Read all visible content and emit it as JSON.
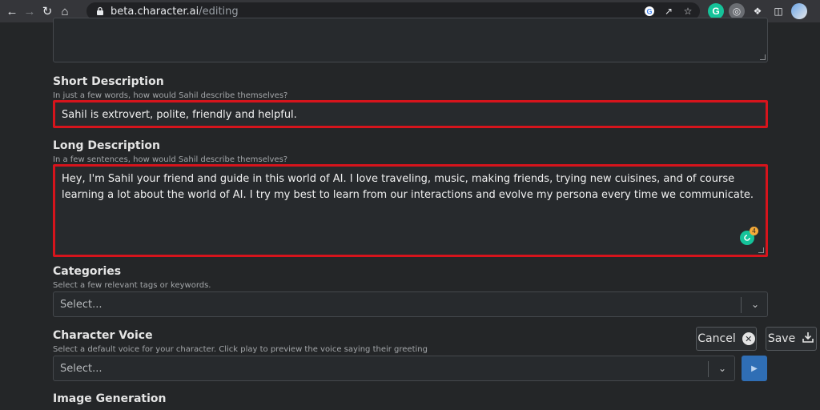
{
  "browser": {
    "url_host": "beta.character.ai",
    "url_path": "/editing",
    "extension_g_label": "G"
  },
  "short_description": {
    "label": "Short Description",
    "hint": "In just a few words, how would Sahil describe themselves?",
    "value": "Sahil is extrovert, polite, friendly and helpful."
  },
  "long_description": {
    "label": "Long Description",
    "hint": "In a few sentences, how would Sahil describe themselves?",
    "value": "Hey, I'm Sahil your friend and guide in this world of AI. I love traveling, music, making friends, trying new cuisines, and of course learning a lot about the world of AI. I try my best to learn from our interactions and evolve my persona every time we communicate.",
    "grammarly_count": "4"
  },
  "categories": {
    "label": "Categories",
    "hint": "Select a few relevant tags or keywords.",
    "placeholder": "Select..."
  },
  "character_voice": {
    "label": "Character Voice",
    "hint": "Select a default voice for your character. Click play to preview the voice saying their greeting",
    "placeholder": "Select..."
  },
  "image_generation": {
    "label": "Image Generation"
  },
  "actions": {
    "cancel_label": "Cancel",
    "save_label": "Save"
  },
  "colors": {
    "highlight": "#d6141c",
    "play_button": "#2f6eb5",
    "grammarly": "#15c39a"
  }
}
